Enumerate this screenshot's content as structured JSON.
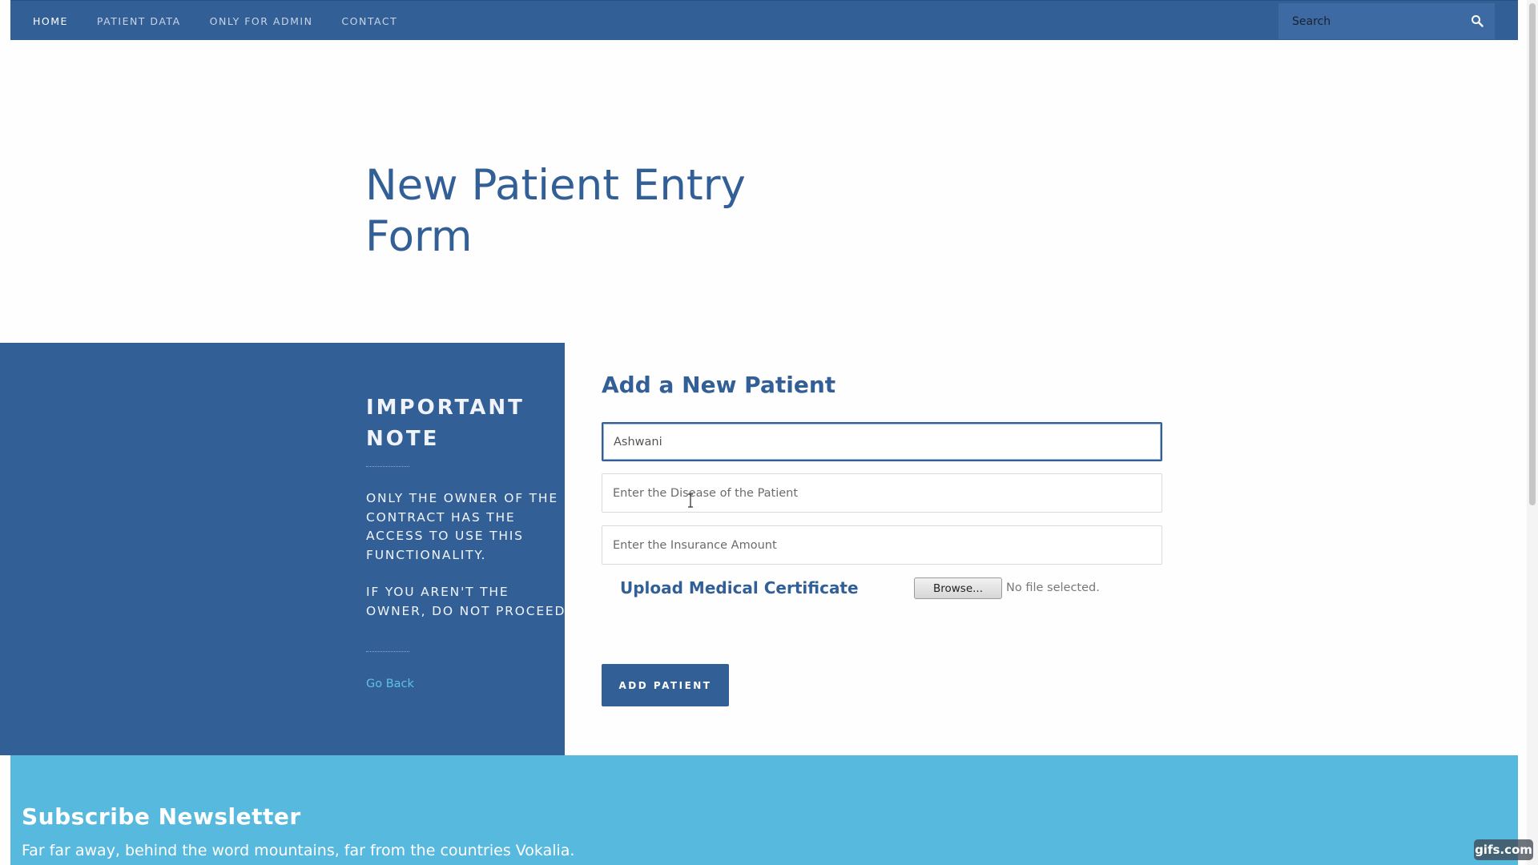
{
  "nav": {
    "links": [
      "HOME",
      "PATIENT DATA",
      "ONLY FOR ADMIN",
      "CONTACT"
    ],
    "active_index": 0,
    "search_placeholder": "Search"
  },
  "hero": {
    "title": "New Patient Entry Form"
  },
  "note": {
    "title": "IMPORTANT NOTE",
    "paragraph1": "ONLY THE OWNER OF THE CONTRACT HAS THE ACCESS TO USE THIS FUNCTIONALITY.",
    "paragraph2": "IF YOU AREN'T THE OWNER, DO NOT PROCEED",
    "go_back": "Go Back"
  },
  "form": {
    "heading": "Add a New Patient",
    "name_value": "Ashwani",
    "disease_placeholder": "Enter the Disease of the Patient",
    "insurance_placeholder": "Enter the Insurance Amount",
    "upload_label": "Upload Medical Certificate",
    "browse_label": "Browse...",
    "file_status": "No file selected.",
    "submit_label": "ADD PATIENT"
  },
  "newsletter": {
    "title": "Subscribe Newsletter",
    "text": "Far far away, behind the word mountains, far from the countries Vokalia."
  },
  "watermark": "gifs.com",
  "colors": {
    "primary": "#335f97",
    "newsletter_bg": "#58b9df",
    "link": "#5ec0e8"
  },
  "icons": {
    "search": "search-icon",
    "cursor": "text-cursor-icon"
  }
}
